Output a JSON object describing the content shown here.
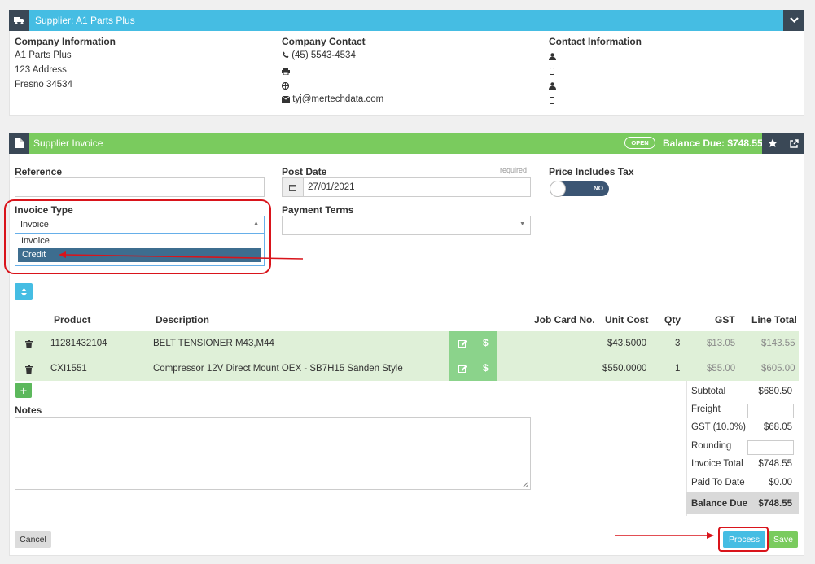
{
  "supplier": {
    "title": "Supplier: A1 Parts Plus",
    "company_info": {
      "heading": "Company Information",
      "lines": [
        "A1 Parts Plus",
        "123 Address",
        "Fresno 34534"
      ]
    },
    "company_contact": {
      "heading": "Company Contact",
      "phone": "(45) 5543-4534",
      "email": "tyj@mertechdata.com"
    },
    "contact_info": {
      "heading": "Contact Information"
    }
  },
  "invoice": {
    "title": "Supplier Invoice",
    "status_badge": "OPEN",
    "balance_due_header": "Balance Due: $748.55",
    "reference_label": "Reference",
    "reference_value": "",
    "post_date_label": "Post Date",
    "required_label": "required",
    "post_date_value": "27/01/2021",
    "price_includes_tax_label": "Price Includes Tax",
    "tax_toggle_value": "NO",
    "invoice_type_label": "Invoice Type",
    "invoice_type_value": "Invoice",
    "invoice_type_options": [
      "Invoice",
      "Credit"
    ],
    "payment_terms_label": "Payment Terms",
    "payment_terms_value": ""
  },
  "table": {
    "headers": {
      "product": "Product",
      "description": "Description",
      "job_card": "Job Card No.",
      "unit_cost": "Unit Cost",
      "qty": "Qty",
      "gst": "GST",
      "line_total": "Line Total"
    },
    "rows": [
      {
        "product": "11281432104",
        "description": "BELT TENSIONER M43,M44",
        "job_card": "",
        "unit_cost": "$43.5000",
        "qty": "3",
        "gst": "$13.05",
        "line_total": "$143.55"
      },
      {
        "product": "CXI1551",
        "description": "Compressor 12V Direct Mount OEX - SB7H15 Sanden Style",
        "job_card": "",
        "unit_cost": "$550.0000",
        "qty": "1",
        "gst": "$55.00",
        "line_total": "$605.00"
      }
    ]
  },
  "notes": {
    "label": "Notes",
    "value": ""
  },
  "totals": {
    "subtotal_label": "Subtotal",
    "subtotal": "$680.50",
    "freight_label": "Freight",
    "freight": "",
    "gst_label": "GST (10.0%)",
    "gst": "$68.05",
    "rounding_label": "Rounding",
    "rounding": "",
    "invoice_total_label": "Invoice Total",
    "invoice_total": "$748.55",
    "paid_label": "Paid To Date",
    "paid": "$0.00",
    "balance_due_label": "Balance Due",
    "balance_due": "$748.55"
  },
  "buttons": {
    "cancel": "Cancel",
    "process": "Process",
    "save": "Save"
  },
  "colors": {
    "header_blue": "#45bde3",
    "header_green": "#7acb5e",
    "dark": "#3a4856",
    "annotation_red": "#d9141b",
    "row_green": "#dff0d8"
  }
}
